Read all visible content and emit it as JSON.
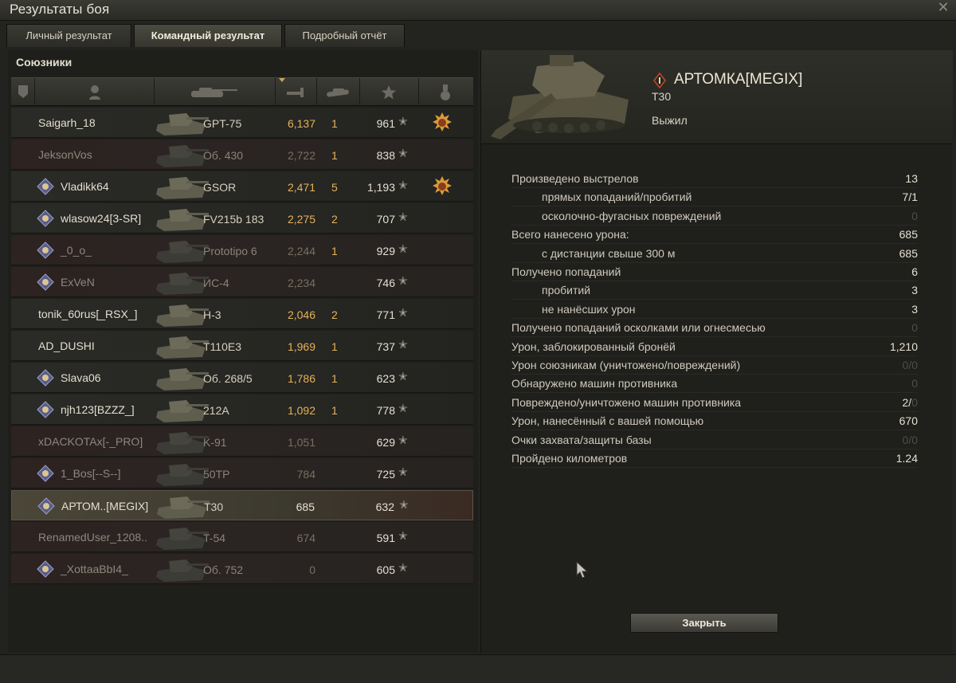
{
  "window": {
    "title": "Результаты боя",
    "close_glyph": "✕"
  },
  "tabs": [
    {
      "label": "Личный результат",
      "active": false
    },
    {
      "label": "Командный результат",
      "active": true
    },
    {
      "label": "Подробный отчёт",
      "active": false
    }
  ],
  "left": {
    "heading": "Союзники",
    "columns": [
      "clan-icon",
      "player-icon",
      "tank-icon",
      "damage-icon",
      "kills-icon",
      "xp-star-icon",
      "medal-icon"
    ],
    "rows": [
      {
        "player": "Saigarh_18",
        "vehicle": "GPT-75",
        "damage": "6,137",
        "kills": "1",
        "xp": "961",
        "clan": false,
        "medal": true,
        "state": "alive"
      },
      {
        "player": "JeksonVos",
        "vehicle": "Об. 430",
        "damage": "2,722",
        "kills": "1",
        "xp": "838",
        "clan": false,
        "medal": false,
        "state": "dead"
      },
      {
        "player": "Vladikk64",
        "vehicle": "GSOR",
        "damage": "2,471",
        "kills": "5",
        "xp": "1,193",
        "clan": true,
        "medal": true,
        "state": "alive"
      },
      {
        "player": "wlasow24[3-SR]",
        "vehicle": "FV215b 183",
        "damage": "2,275",
        "kills": "2",
        "xp": "707",
        "clan": true,
        "medal": false,
        "state": "alive"
      },
      {
        "player": "_0_o_",
        "vehicle": "Prototipo 6",
        "damage": "2,244",
        "kills": "1",
        "xp": "929",
        "clan": true,
        "medal": false,
        "state": "dead"
      },
      {
        "player": "ExVeN",
        "vehicle": "ИС-4",
        "damage": "2,234",
        "kills": "",
        "xp": "746",
        "clan": true,
        "medal": false,
        "state": "dead"
      },
      {
        "player": "tonik_60rus[_RSX_]",
        "vehicle": "H-3",
        "damage": "2,046",
        "kills": "2",
        "xp": "771",
        "clan": false,
        "medal": false,
        "state": "alive"
      },
      {
        "player": "AD_DUSHI",
        "vehicle": "T110E3",
        "damage": "1,969",
        "kills": "1",
        "xp": "737",
        "clan": false,
        "medal": false,
        "state": "alive"
      },
      {
        "player": "Slava06",
        "vehicle": "Об. 268/5",
        "damage": "1,786",
        "kills": "1",
        "xp": "623",
        "clan": true,
        "medal": false,
        "state": "alive"
      },
      {
        "player": "njh123[BZZZ_]",
        "vehicle": "212A",
        "damage": "1,092",
        "kills": "1",
        "xp": "778",
        "clan": true,
        "medal": false,
        "state": "alive"
      },
      {
        "player": "xDACKOTAx[-_PRO]",
        "vehicle": "K-91",
        "damage": "1,051",
        "kills": "",
        "xp": "629",
        "clan": false,
        "medal": false,
        "state": "dead"
      },
      {
        "player": "1_Bos[--S--]",
        "vehicle": "50TP",
        "damage": "784",
        "kills": "",
        "xp": "725",
        "clan": true,
        "medal": false,
        "state": "dead"
      },
      {
        "player": "АРТОМ..[MEGIX]",
        "vehicle": "T30",
        "damage": "685",
        "kills": "",
        "xp": "632",
        "clan": true,
        "medal": false,
        "state": "self"
      },
      {
        "player": "RenamedUser_1208..",
        "vehicle": "T-54",
        "damage": "674",
        "kills": "",
        "xp": "591",
        "clan": false,
        "medal": false,
        "state": "dead"
      },
      {
        "player": "_XottaaBbI4_",
        "vehicle": "Об. 752",
        "damage": "0",
        "kills": "",
        "xp": "605",
        "clan": true,
        "medal": false,
        "state": "dead"
      }
    ],
    "star_glyph": "✭"
  },
  "right": {
    "player_name": "АРТОМКА[MEGIX]",
    "vehicle": "T30",
    "status": "Выжил",
    "stats": [
      {
        "label": "Произведено выстрелов",
        "value": "13",
        "sub": false
      },
      {
        "label": "прямых попаданий/пробитий",
        "value": "7/1",
        "sub": true
      },
      {
        "label": "осколочно-фугасных повреждений",
        "value": "0",
        "sub": true,
        "dim": true
      },
      {
        "label": "Всего нанесено урона:",
        "value": "685",
        "sub": false
      },
      {
        "label": "с дистанции свыше 300 м",
        "value": "685",
        "sub": true
      },
      {
        "label": "Получено попаданий",
        "value": "6",
        "sub": false
      },
      {
        "label": "пробитий",
        "value": "3",
        "sub": true
      },
      {
        "label": "не нанёсших урон",
        "value": "3",
        "sub": true
      },
      {
        "label": "Получено попаданий осколками или огнесмесью",
        "value": "0",
        "sub": false,
        "dim": true
      },
      {
        "label": "Урон, заблокированный бронёй",
        "value": "1,210",
        "sub": false
      },
      {
        "label": "Урон союзникам (уничтожено/повреждений)",
        "value": "0/0",
        "sub": false,
        "dim": true
      },
      {
        "label": "Обнаружено машин противника",
        "value": "0",
        "sub": false,
        "dim": true
      },
      {
        "label": "Повреждено/уничтожено машин противника",
        "value": "2/",
        "value_dim": "0",
        "sub": false
      },
      {
        "label": "Урон, нанесённый с вашей помощью",
        "value": "670",
        "sub": false
      },
      {
        "label": "Очки захвата/защиты базы",
        "value": "0/0",
        "sub": false,
        "dim": true
      },
      {
        "label": "Пройдено километров",
        "value": "1.24",
        "sub": false
      }
    ],
    "close_label": "Закрыть"
  }
}
